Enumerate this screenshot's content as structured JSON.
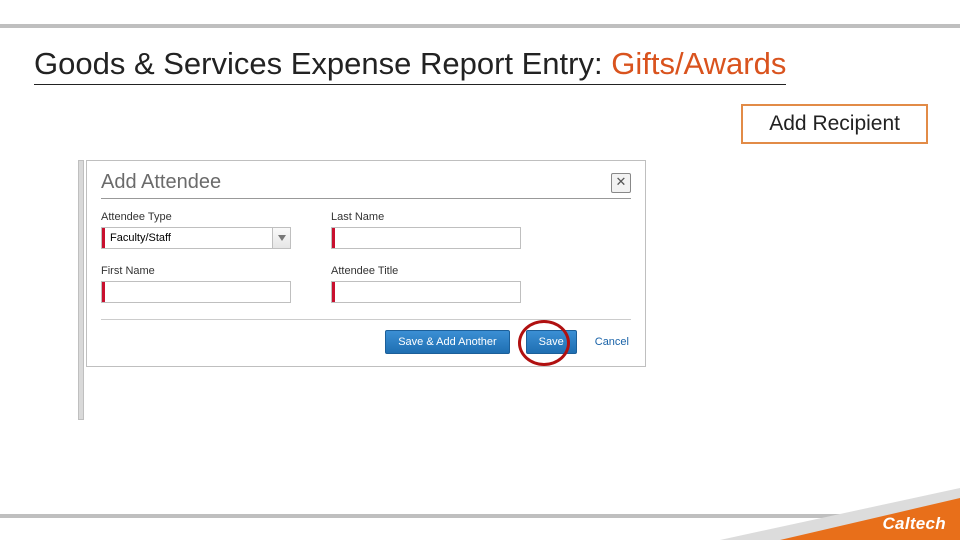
{
  "slide": {
    "title_plain": "Goods & Services Expense Report Entry: ",
    "title_accent": "Gifts/Awards"
  },
  "callout": {
    "label": "Add Recipient"
  },
  "dialog": {
    "title": "Add Attendee",
    "close_glyph": "✕",
    "fields": {
      "attendee_type": {
        "label": "Attendee Type",
        "value": "Faculty/Staff"
      },
      "last_name": {
        "label": "Last Name",
        "value": ""
      },
      "first_name": {
        "label": "First Name",
        "value": ""
      },
      "attendee_title": {
        "label": "Attendee Title",
        "value": ""
      }
    },
    "buttons": {
      "save_add": "Save & Add Another",
      "save": "Save",
      "cancel": "Cancel"
    }
  },
  "footer": {
    "logo": "Caltech"
  }
}
